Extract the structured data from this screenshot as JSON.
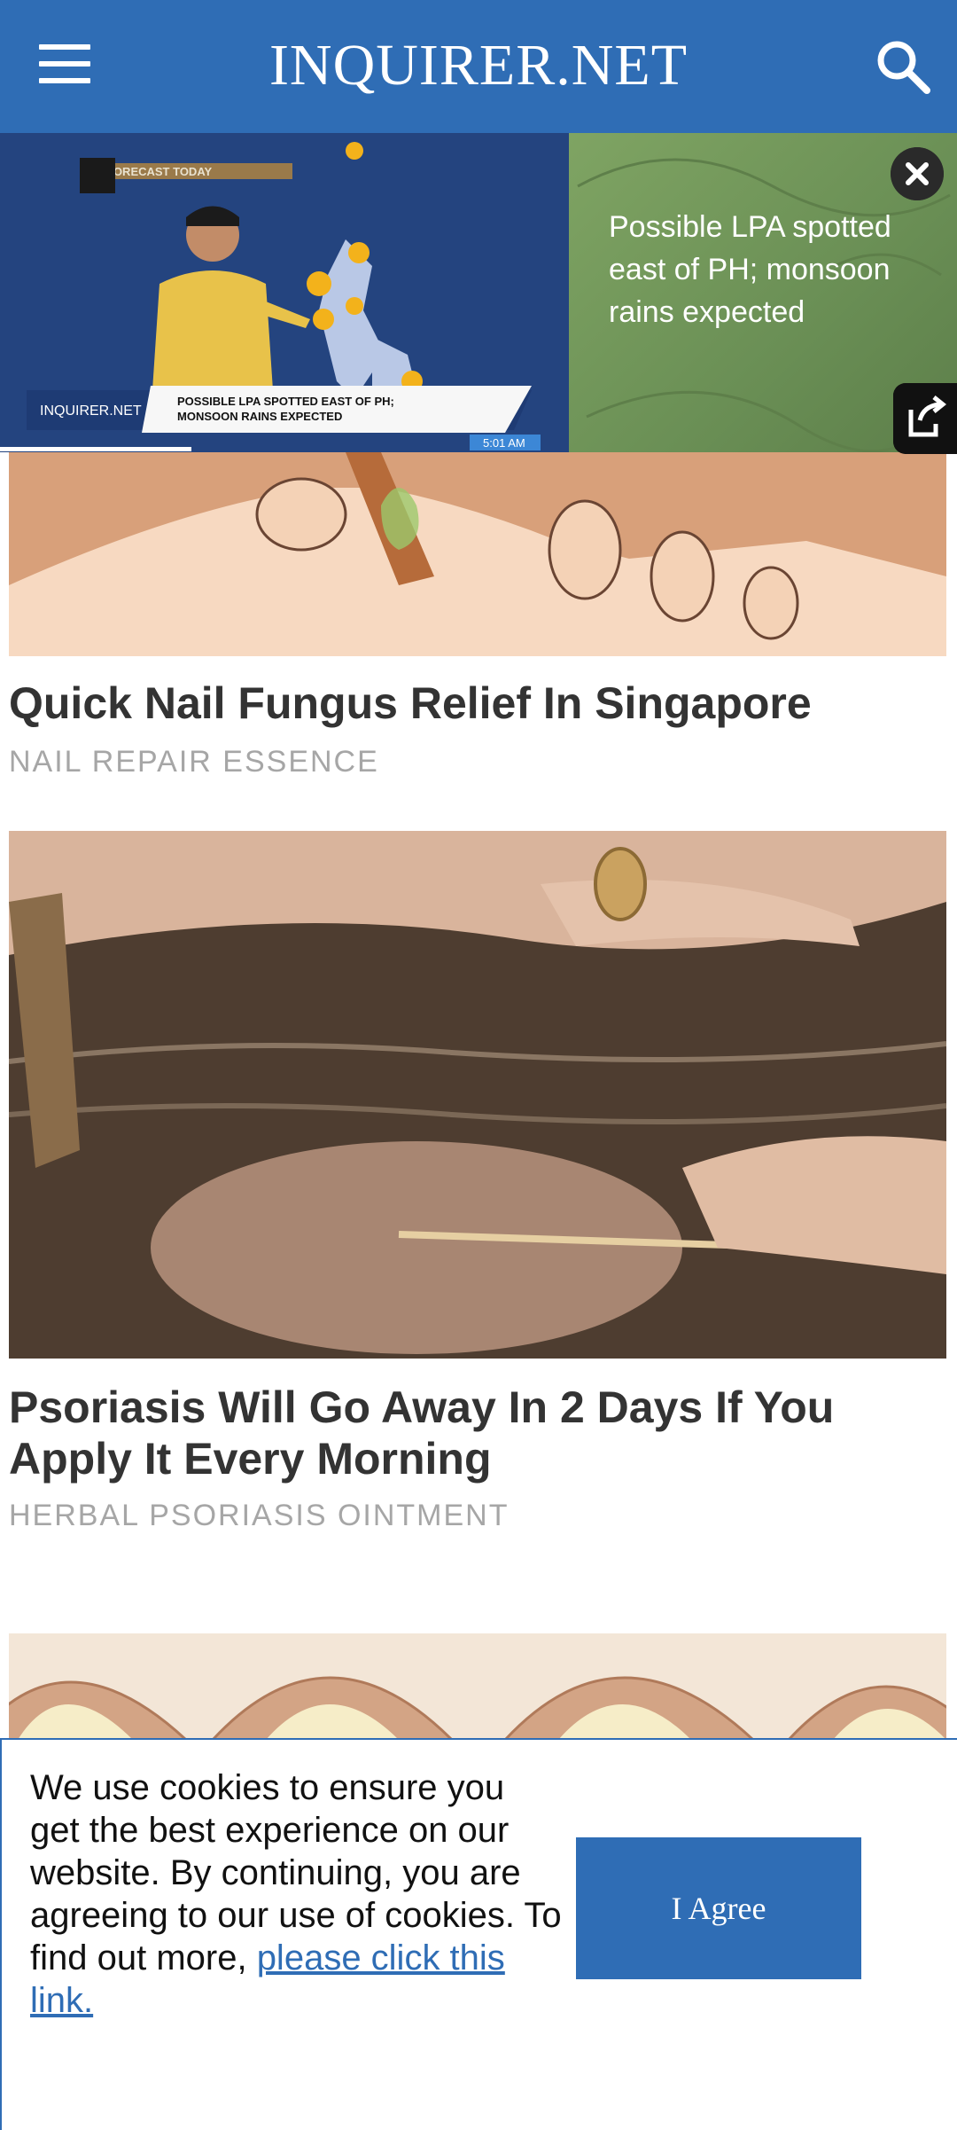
{
  "header": {
    "logo": "INQUIRER.NET",
    "menu_icon": "hamburger-menu-icon",
    "search_icon": "search-icon",
    "background": "#2f6db5"
  },
  "video": {
    "caption": "Possible LPA spotted east of PH; monsoon rains expected",
    "thumb_banner_brand": "INQUIRER.NET",
    "thumb_banner_headline_1": "POSSIBLE LPA SPOTTED EAST OF PH;",
    "thumb_banner_headline_2": "MONSOON RAINS EXPECTED",
    "thumb_segment": "FORECAST TODAY",
    "thumb_time": "5:01 AM",
    "close_icon": "close-icon",
    "share_icon": "share-icon",
    "progress": 0.2
  },
  "articles": [
    {
      "headline": "Quick Nail Fungus Relief In Singapore",
      "source": "NAIL REPAIR ESSENCE"
    },
    {
      "headline": "Psoriasis Will Go Away In 2 Days If You Apply It Every Morning",
      "source": "HERBAL PSORIASIS OINTMENT"
    }
  ],
  "cookie": {
    "text": "We use cookies to ensure you get the best experience on our website. By continuing, you are agreeing to our use of cookies. To find out more, ",
    "link_text": "please click this link.",
    "button_label": "I Agree"
  }
}
